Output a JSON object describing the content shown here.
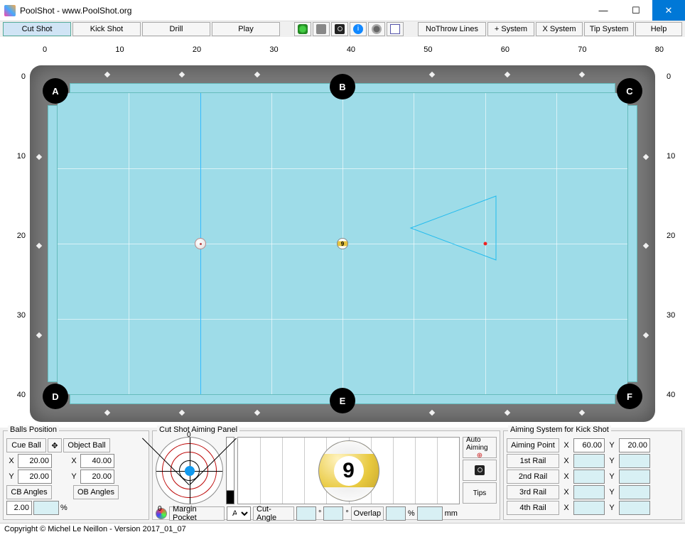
{
  "window": {
    "title": "PoolShot - www.PoolShot.org"
  },
  "toolbar": {
    "cut_shot": "Cut Shot",
    "kick_shot": "Kick Shot",
    "drill": "Drill",
    "play": "Play",
    "nothrow": "NoThrow Lines",
    "plus_system": "+ System",
    "x_system": "X System",
    "tip_system": "Tip System",
    "help": "Help"
  },
  "ruler": {
    "top": [
      "0",
      "10",
      "20",
      "30",
      "40",
      "50",
      "60",
      "70",
      "80"
    ],
    "left": [
      "0",
      "10",
      "20",
      "30",
      "40"
    ],
    "right": [
      "0",
      "10",
      "20",
      "30",
      "40"
    ]
  },
  "pockets": {
    "a": "A",
    "b": "B",
    "c": "C",
    "d": "D",
    "e": "E",
    "f": "F"
  },
  "balls_position": {
    "title": "Balls Position",
    "cue_ball_btn": "Cue Ball",
    "object_ball_btn": "Object Ball",
    "x_label": "X",
    "y_label": "Y",
    "cue_x": "20.00",
    "cue_y": "20.00",
    "obj_x": "40.00",
    "obj_y": "20.00",
    "cb_angles": "CB Angles",
    "ob_angles": "OB Angles",
    "angle_val": "2.00",
    "pct": "%"
  },
  "aim_panel": {
    "title": "Cut Shot Aiming Panel",
    "zero": "0",
    "auto_aiming": "Auto Aiming",
    "tips": "Tips",
    "margin_pocket": "Margin Pocket",
    "pocket_sel": "A",
    "cut_angle": "Cut-Angle",
    "deg": "°",
    "overlap": "Overlap",
    "pct": "%",
    "mm": "mm",
    "nine": "9"
  },
  "kick_panel": {
    "title": "Aiming System for Kick Shot",
    "aiming_point": "Aiming Point",
    "rail1": "1st Rail",
    "rail2": "2nd Rail",
    "rail3": "3rd Rail",
    "rail4": "4th Rail",
    "x": "X",
    "y": "Y",
    "ap_x": "60.00",
    "ap_y": "20.00"
  },
  "status": {
    "text": "Copyright © Michel Le Neillon - Version 2017_01_07"
  }
}
